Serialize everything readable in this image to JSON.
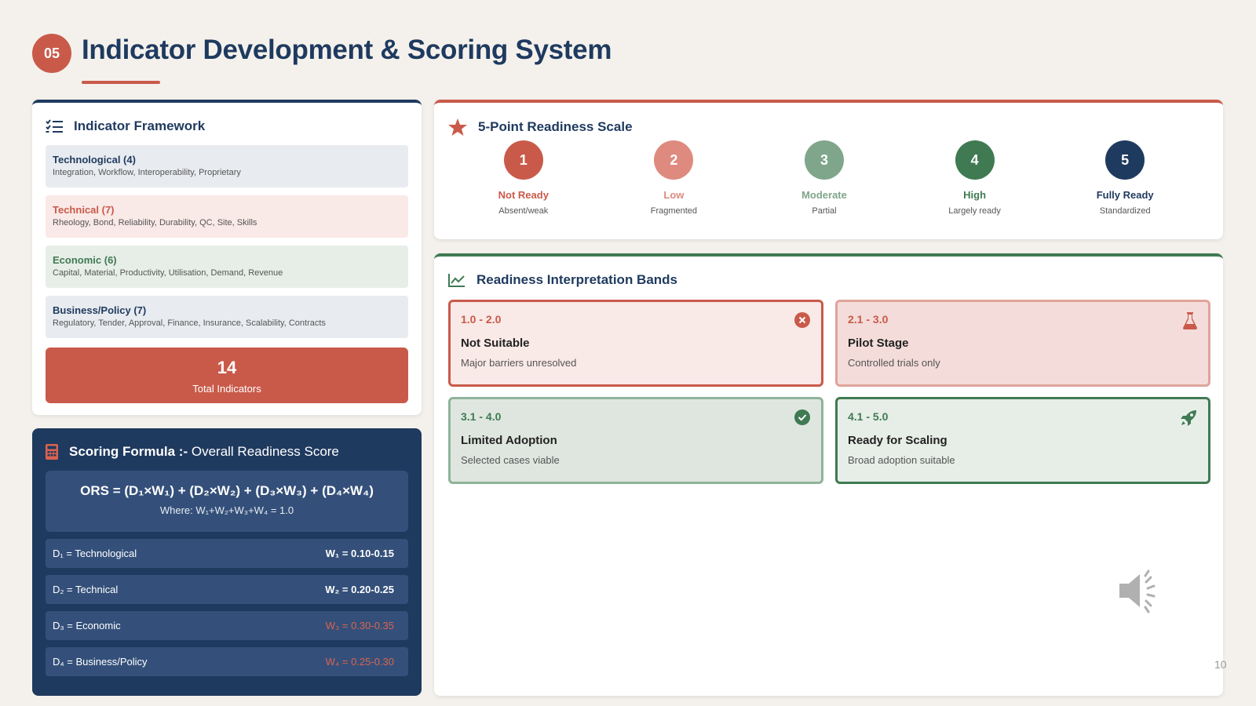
{
  "header": {
    "section_number": "05",
    "title": "Indicator Development & Scoring System"
  },
  "framework": {
    "title": "Indicator Framework",
    "items": [
      {
        "title": "Technological (4)",
        "subtitle": "Integration, Workflow, Interoperability, Proprietary"
      },
      {
        "title": "Technical (7)",
        "subtitle": "Rheology, Bond, Reliability, Durability, QC, Site, Skills"
      },
      {
        "title": "Economic (6)",
        "subtitle": "Capital, Material, Productivity, Utilisation, Demand, Revenue"
      },
      {
        "title": "Business/Policy (7)",
        "subtitle": "Regulatory, Tender, Approval, Finance, Insurance, Scalability, Contracts"
      }
    ],
    "total_value": "14",
    "total_label": "Total Indicators"
  },
  "formula": {
    "title_bold": "Scoring Formula :-",
    "title_rest": "Overall Readiness Score",
    "equation": "ORS = (D₁×W₁) + (D₂×W₂) + (D₃×W₃) + (D₄×W₄)",
    "where": "Where: W₁+W₂+W₃+W₄ = 1.0",
    "dimensions": [
      {
        "name": "D₁ = Technological",
        "weight": "W₁ = 0.10-0.15"
      },
      {
        "name": "D₂ = Technical",
        "weight": "W₂ = 0.20-0.25"
      },
      {
        "name": "D₃ = Economic",
        "weight": "W₃ = 0.30-0.35"
      },
      {
        "name": "D₄ = Business/Policy",
        "weight": "W₄ = 0.25-0.30"
      }
    ]
  },
  "scale": {
    "title": "5-Point Readiness Scale",
    "levels": [
      {
        "number": "1",
        "label": "Not Ready",
        "desc": "Absent/weak",
        "color": "#c95a4a"
      },
      {
        "number": "2",
        "label": "Low",
        "desc": "Fragmented",
        "color": "#de8a7e"
      },
      {
        "number": "3",
        "label": "Moderate",
        "desc": "Partial",
        "color": "#7fa68a"
      },
      {
        "number": "4",
        "label": "High",
        "desc": "Largely ready",
        "color": "#3f7a52"
      },
      {
        "number": "5",
        "label": "Fully Ready",
        "desc": "Standardized",
        "color": "#1f3a5f"
      }
    ]
  },
  "bands": {
    "title": "Readiness Interpretation Bands",
    "items": [
      {
        "range": "1.0 - 2.0",
        "title": "Not Suitable",
        "desc": "Major barriers unresolved",
        "icon": "x-circle-icon"
      },
      {
        "range": "2.1 - 3.0",
        "title": "Pilot Stage",
        "desc": "Controlled trials only",
        "icon": "flask-icon"
      },
      {
        "range": "3.1 - 4.0",
        "title": "Limited Adoption",
        "desc": "Selected cases viable",
        "icon": "check-circle-icon"
      },
      {
        "range": "4.1 - 5.0",
        "title": "Ready for Scaling",
        "desc": "Broad adoption suitable",
        "icon": "rocket-icon"
      }
    ]
  },
  "page_number": "10"
}
